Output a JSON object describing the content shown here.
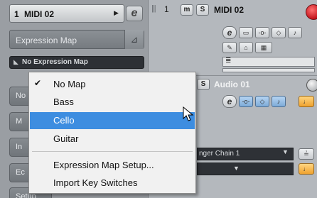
{
  "inspector": {
    "track_number": "1",
    "track_name": "MIDI 02",
    "section_title": "Expression Map",
    "current_map": "No Expression Map",
    "side_tabs": [
      "No",
      "M",
      "In",
      "Ec",
      "Setup"
    ]
  },
  "tracklist": {
    "track1": {
      "number": "1",
      "name": "MIDI 02",
      "mute": "m",
      "solo": "S"
    },
    "track2": {
      "name": "Audio 01",
      "solo": "S"
    },
    "chain_field": "nger Chain 1"
  },
  "menu": {
    "items": [
      {
        "label": "No Map",
        "checked": true
      },
      {
        "label": "Bass",
        "checked": false
      },
      {
        "label": "Cello",
        "checked": false,
        "highlighted": true
      },
      {
        "label": "Guitar",
        "checked": false
      }
    ],
    "footer_items": [
      {
        "label": "Expression Map Setup..."
      },
      {
        "label": "Import Key Switches"
      }
    ],
    "check_glyph": "✔"
  },
  "colors": {
    "menu_highlight": "#3d8de0",
    "record": "#c3131b",
    "accent_blue": "#7daad8",
    "accent_orange": "#efa22f"
  }
}
